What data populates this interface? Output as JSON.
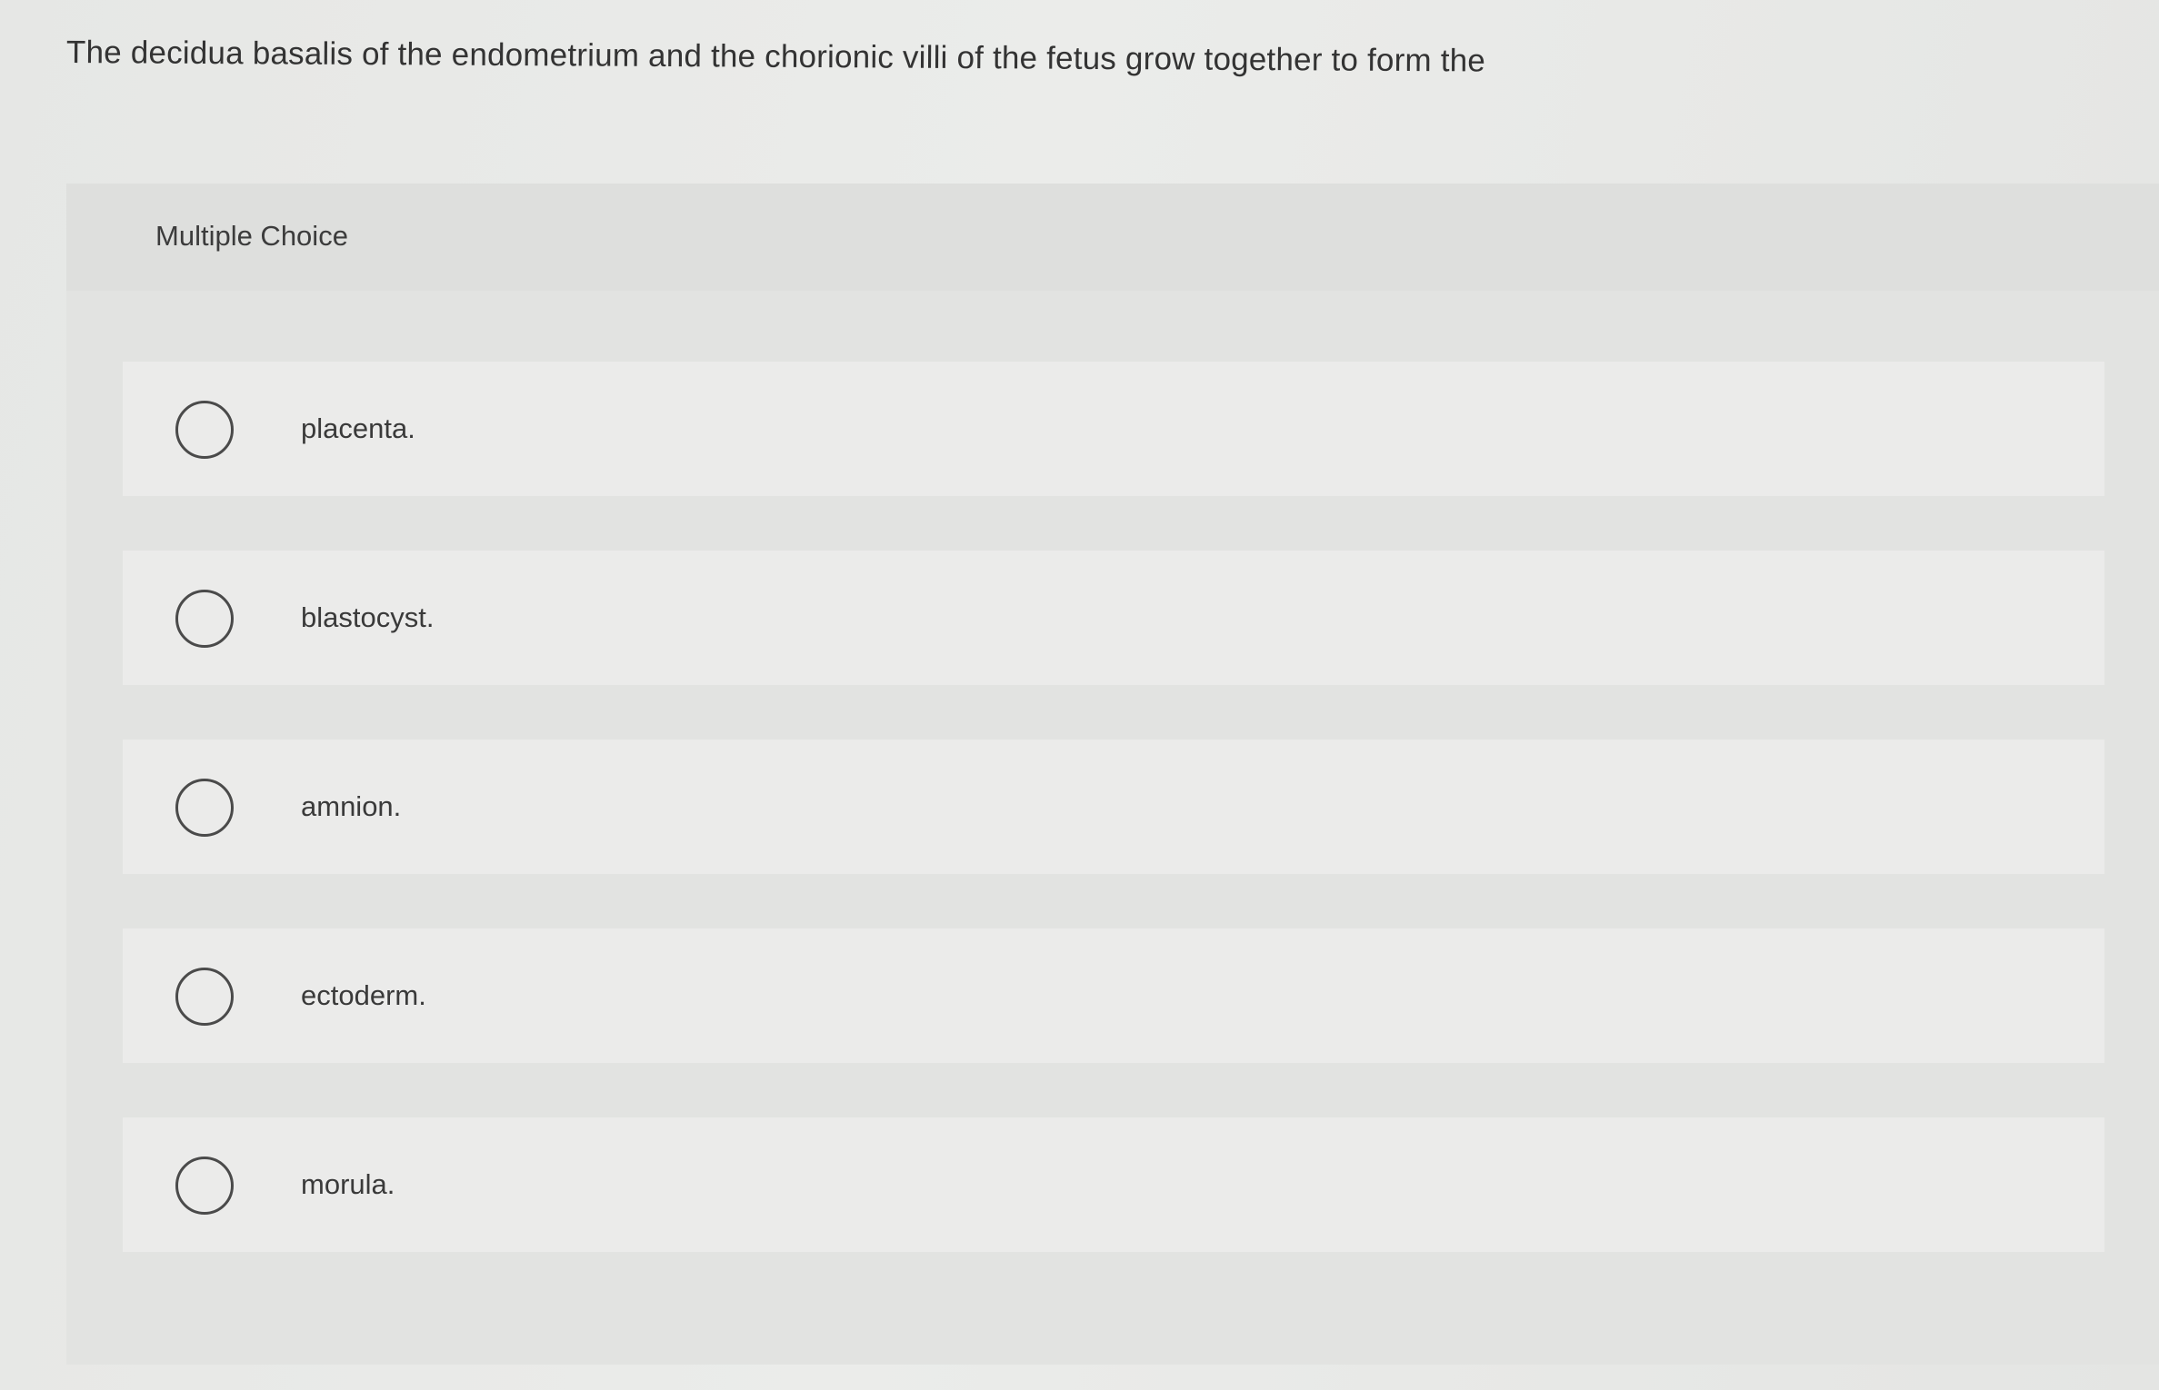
{
  "question": {
    "text": "The decidua basalis of the endometrium and the chorionic villi of the fetus grow together to form the"
  },
  "panel": {
    "title": "Multiple Choice"
  },
  "options": [
    {
      "label": "placenta."
    },
    {
      "label": "blastocyst."
    },
    {
      "label": "amnion."
    },
    {
      "label": "ectoderm."
    },
    {
      "label": "morula."
    }
  ]
}
